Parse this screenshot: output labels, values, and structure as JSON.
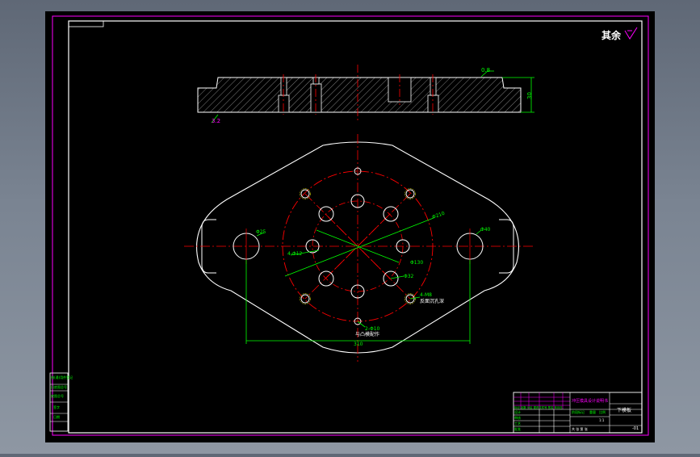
{
  "colors": {
    "canvas": "#000000",
    "frame": "#ff00ff",
    "outline": "#ffffff",
    "center_line": "#ff0000",
    "dimension": "#00ff00",
    "hatch": "#ffffff"
  },
  "roughness_note": "其余",
  "section_view": {
    "top_dimension": "0.8",
    "height_dimension": "30",
    "bottom_note": "3.2"
  },
  "plan_view": {
    "left_hole_dim": "Φ25",
    "right_hole_dim": "Φ40",
    "pcd_outer": "Φ210",
    "pcd_inner": "Φ130",
    "small_holes": "4-Φ12",
    "center_hole": "Φ32",
    "tapped_holes": "4-M8",
    "tapped_note": "反面沉孔深",
    "pin_holes": "2-Φ10",
    "pin_note": "与凸模配作",
    "width_dim": "310"
  },
  "title_block": {
    "drawing_name": "下模板",
    "part_no": "-01",
    "project": "冲压模具设计说明书",
    "header_row": "标记 处数 分区 更改文件号 签名 年月日",
    "rows": [
      "设计",
      "审核",
      "工艺",
      "批准"
    ],
    "stage": "阶段标记",
    "weight": "重量",
    "scale": "比例",
    "scale_value": "1:1",
    "sheet": "共 张 第 张"
  },
  "side_table": [
    "借(通)用件登记",
    "旧底图总号",
    "底图总号",
    "签字",
    "日期"
  ]
}
